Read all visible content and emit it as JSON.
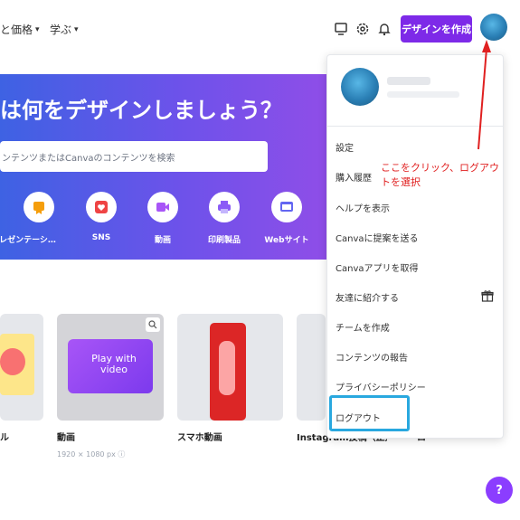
{
  "topnav": {
    "items": [
      {
        "label": "と価格"
      },
      {
        "label": "学ぶ"
      }
    ],
    "create_label": "デザインを作成"
  },
  "hero": {
    "title": "は何をデザインしましょう？",
    "search_placeholder": "ンテンツまたはCanvaのコンテンツを検索",
    "categories": [
      {
        "label": "プレゼンテーシ…",
        "icon": "badge-icon",
        "color": "#f59e0b"
      },
      {
        "label": "SNS",
        "icon": "heart-icon",
        "color": "#ef4444"
      },
      {
        "label": "動画",
        "icon": "video-icon",
        "color": "#a855f7"
      },
      {
        "label": "印刷製品",
        "icon": "printer-icon",
        "color": "#8b5cf6"
      },
      {
        "label": "Webサイト",
        "icon": "monitor-icon",
        "color": "#6366f1"
      }
    ]
  },
  "templates": {
    "labels": [
      "ル",
      "動画",
      "スマホ動画",
      "Instagram投稿（正方形）",
      "ロ"
    ],
    "video_thumb_text": "Play with video",
    "video_dimensions": "1920 × 1080 px"
  },
  "menu": {
    "items": [
      {
        "label": "設定"
      },
      {
        "label": "購入履歴"
      },
      {
        "label": "ヘルプを表示"
      },
      {
        "label": "Canvaに提案を送る"
      },
      {
        "label": "Canvaアプリを取得"
      },
      {
        "label": "友達に紹介する"
      },
      {
        "label": "チームを作成"
      },
      {
        "label": "コンテンツの報告"
      },
      {
        "label": "プライバシーポリシー"
      },
      {
        "label": "ログアウト"
      }
    ]
  },
  "annotation": {
    "text": "ここをクリック、ログアウトを選択",
    "color": "#e02020"
  },
  "help": {
    "label": "?"
  },
  "colors": {
    "brand_purple": "#7d2ae8",
    "highlight_blue": "#29a8df"
  }
}
